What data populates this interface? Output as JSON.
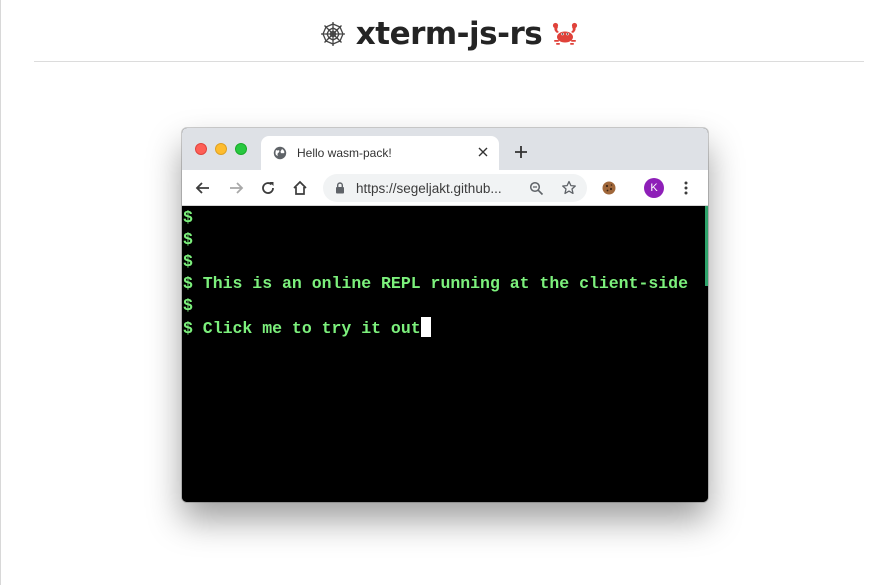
{
  "heading": {
    "title": "xterm-js-rs",
    "left_emoji": "spider-web-icon",
    "right_emoji": "crab-icon"
  },
  "browser": {
    "tab": {
      "title": "Hello wasm-pack!",
      "icon": "globe-icon"
    },
    "toolbar": {
      "url": "https://segeljakt.github...",
      "avatar_initial": "K"
    }
  },
  "terminal": {
    "lines": [
      "$",
      "$",
      "$",
      "$ This is an online REPL running at the client-side",
      "$",
      "$ Click me to try it out"
    ],
    "colors": {
      "text": "#7cf07c",
      "background": "#000000",
      "cursor": "#ffffff"
    }
  }
}
